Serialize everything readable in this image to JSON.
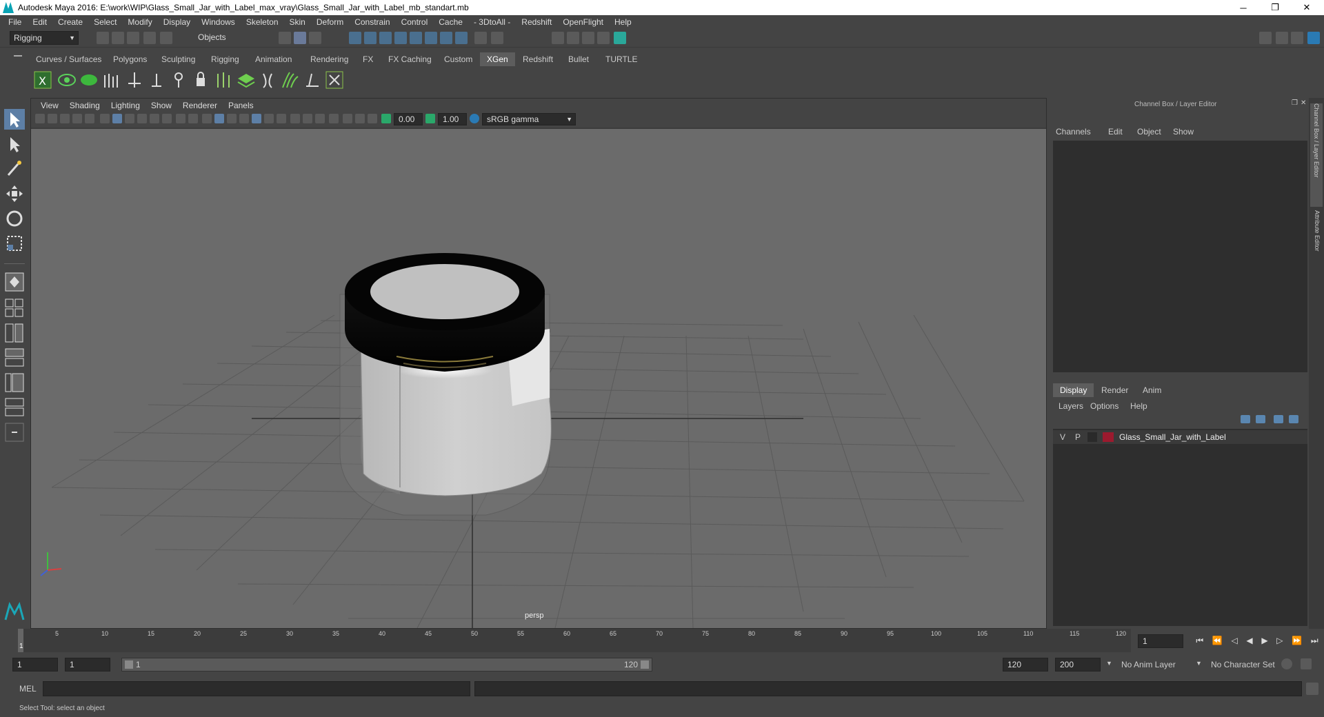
{
  "window": {
    "title": "Autodesk Maya 2016: E:\\work\\WIP\\Glass_Small_Jar_with_Label_max_vray\\Glass_Small_Jar_with_Label_mb_standart.mb",
    "minimize": "─",
    "restore": "❐",
    "close": "✕"
  },
  "menubar": [
    "File",
    "Edit",
    "Create",
    "Select",
    "Modify",
    "Display",
    "Windows",
    "Skeleton",
    "Skin",
    "Deform",
    "Constrain",
    "Control",
    "Cache",
    "- 3DtoAll -",
    "Redshift",
    "OpenFlight",
    "Help"
  ],
  "statusline": {
    "mode": "Rigging",
    "selection_mode": "Objects"
  },
  "shelf_tabs": [
    "Curves / Surfaces",
    "Polygons",
    "Sculpting",
    "Rigging",
    "Animation",
    "Rendering",
    "FX",
    "FX Caching",
    "Custom",
    "XGen",
    "Redshift",
    "Bullet",
    "TURTLE"
  ],
  "active_shelf": "XGen",
  "viewport": {
    "menu": [
      "View",
      "Shading",
      "Lighting",
      "Show",
      "Renderer",
      "Panels"
    ],
    "exposure": "0.00",
    "gamma": "1.00",
    "color_space": "sRGB gamma",
    "camera_label": "persp"
  },
  "channel_box": {
    "title": "Channel Box / Layer Editor",
    "menu": [
      "Channels",
      "Edit",
      "Object",
      "Show"
    ]
  },
  "layer_editor": {
    "tabs": [
      "Display",
      "Render",
      "Anim"
    ],
    "active_tab": "Display",
    "menu": [
      "Layers",
      "Options",
      "Help"
    ],
    "layers": [
      {
        "v": "V",
        "p": "P",
        "name": "Glass_Small_Jar_with_Label",
        "color": "#9b1a2e"
      }
    ]
  },
  "side_tabs": [
    "Channel Box / Layer Editor",
    "Attribute Editor"
  ],
  "timeline": {
    "ticks": [
      "1",
      "5",
      "10",
      "15",
      "20",
      "25",
      "30",
      "35",
      "40",
      "45",
      "50",
      "55",
      "60",
      "65",
      "70",
      "75",
      "80",
      "85",
      "90",
      "95",
      "100",
      "105",
      "110",
      "115",
      "120"
    ],
    "current_frame": "1"
  },
  "range": {
    "start": "1",
    "anim_start": "1",
    "slider_start": "1",
    "slider_end": "120",
    "end": "120",
    "anim_end": "200",
    "anim_layer": "No Anim Layer",
    "char_set": "No Character Set"
  },
  "cmdline": {
    "label": "MEL"
  },
  "helpline": "Select Tool: select an object",
  "colors": {
    "accent": "#5d5d5d",
    "viewport_bg": "#6b6b6b",
    "panel": "#444444",
    "field": "#2b2b2b"
  }
}
